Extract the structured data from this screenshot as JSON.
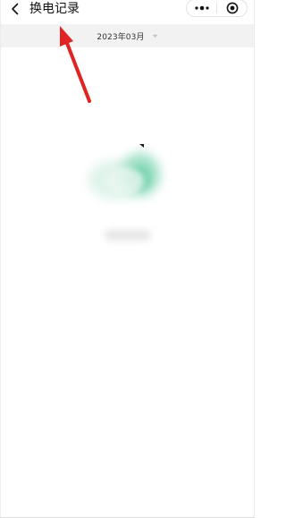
{
  "navbar": {
    "title": "换电记录",
    "back_icon": "chevron-left-icon",
    "capsule": {
      "more_icon": "more-dots-icon",
      "close_icon": "target-circle-icon"
    }
  },
  "month_picker": {
    "value": "2023年03月",
    "caret_icon": "caret-down-icon"
  },
  "empty_state": {
    "illustration_icon": "empty-records-illustration",
    "text": ""
  },
  "annotation": {
    "arrow_color": "#e02424"
  }
}
